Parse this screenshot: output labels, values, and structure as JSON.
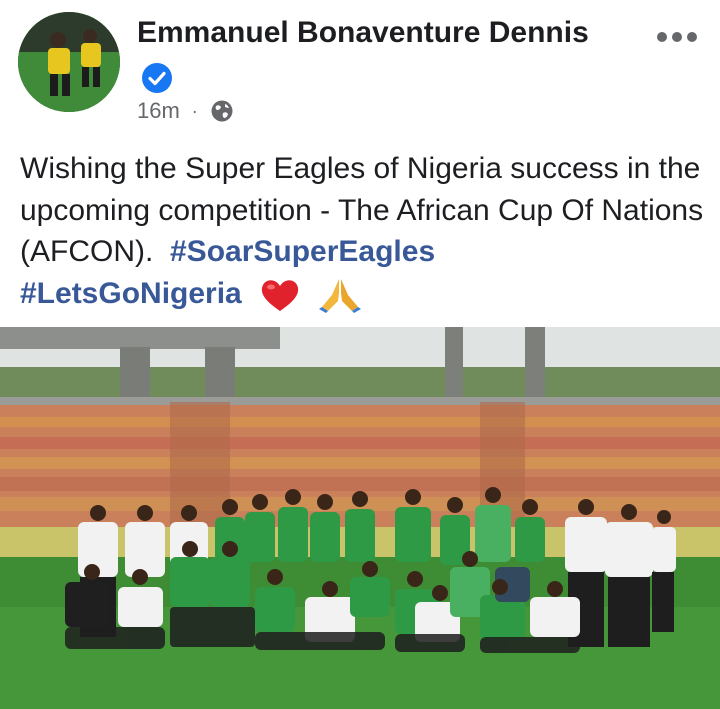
{
  "post": {
    "author_name": "Emmanuel Bonaventure Dennis",
    "timestamp": "16m",
    "separator": "·",
    "body_text": "Wishing the Super Eagles of Nigeria success in the upcoming competition - The African Cup Of Nations (AFCON).",
    "hashtags": [
      "#SoarSuperEagles",
      "#LetsGoNigeria"
    ],
    "icons": {
      "verified": "verified-badge-icon",
      "audience": "globe-icon",
      "more": "more-options-icon",
      "heart": "red-heart-emoji",
      "hands": "folded-hands-emoji"
    },
    "colors": {
      "hashtag": "#385898",
      "verified": "#1877f2",
      "meta": "#65676b"
    }
  }
}
